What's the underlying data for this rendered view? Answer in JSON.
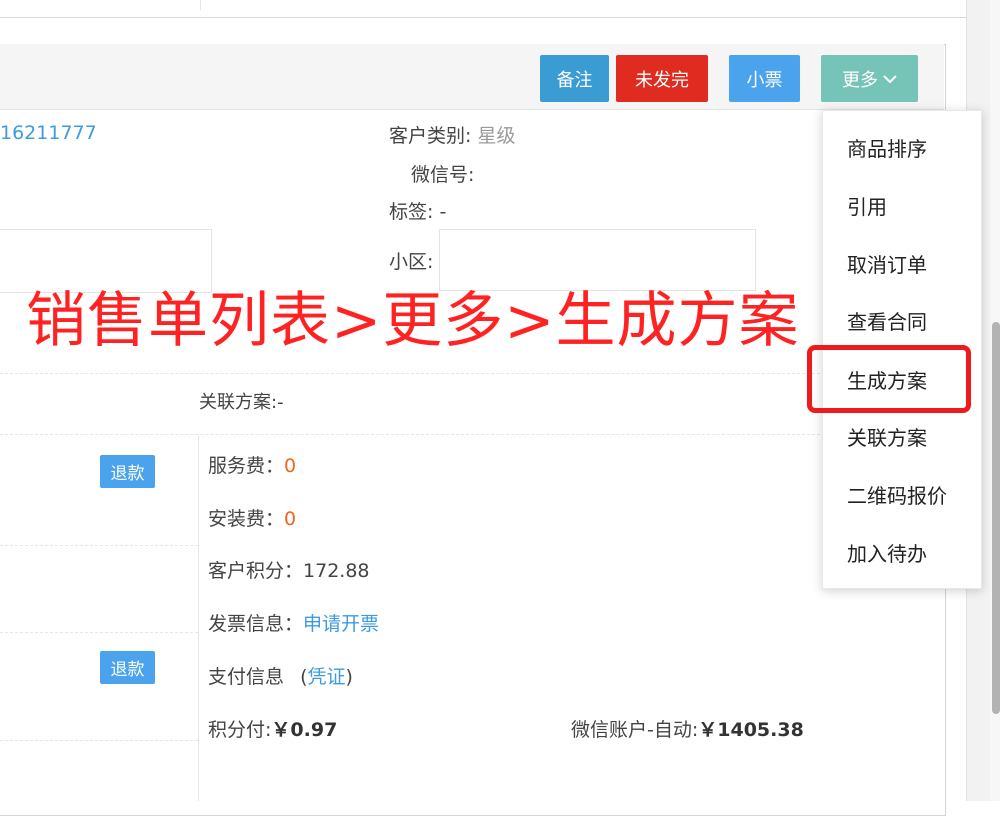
{
  "header": {
    "buttons": {
      "remark": "备注",
      "unshipped": "未发完",
      "receipt": "小票",
      "more": "更多"
    }
  },
  "customer": {
    "phone_partial": "16211777",
    "type_label": "客户类别:",
    "type_value": "星级",
    "wechat_label": "微信号:",
    "tags_label": "标签:",
    "tags_value": "-",
    "community_label": "小区:"
  },
  "annotation": "销售单列表>更多>生成方案",
  "related_plan": "关联方案:-",
  "refund_label": "退款",
  "fees": {
    "service_label": "服务费：",
    "service_value": "0",
    "install_label": "安装费：",
    "install_value": "0",
    "points_label": "客户积分：",
    "points_value": "172.88",
    "invoice_label": "发票信息：",
    "invoice_link": "申请开票",
    "payment_label": "支付信息",
    "payment_open": "(",
    "payment_link": "凭证",
    "payment_close": ")",
    "points_pay_label": "积分付:",
    "points_pay_value": "￥0.97",
    "wechat_pay_label": "微信账户-自动:",
    "wechat_pay_value": "￥1405.38"
  },
  "more_menu": {
    "items": [
      "商品排序",
      "引用",
      "取消订单",
      "查看合同",
      "生成方案",
      "关联方案",
      "二维码报价",
      "加入待办"
    ],
    "highlighted": "生成方案"
  },
  "colors": {
    "remark": "#3b9bd3",
    "unshipped": "#e02b20",
    "receipt": "#4aa3ec",
    "more": "#76c3b8",
    "annotation": "#ff2222",
    "link": "#3d9be0",
    "amount": "#f26522"
  }
}
